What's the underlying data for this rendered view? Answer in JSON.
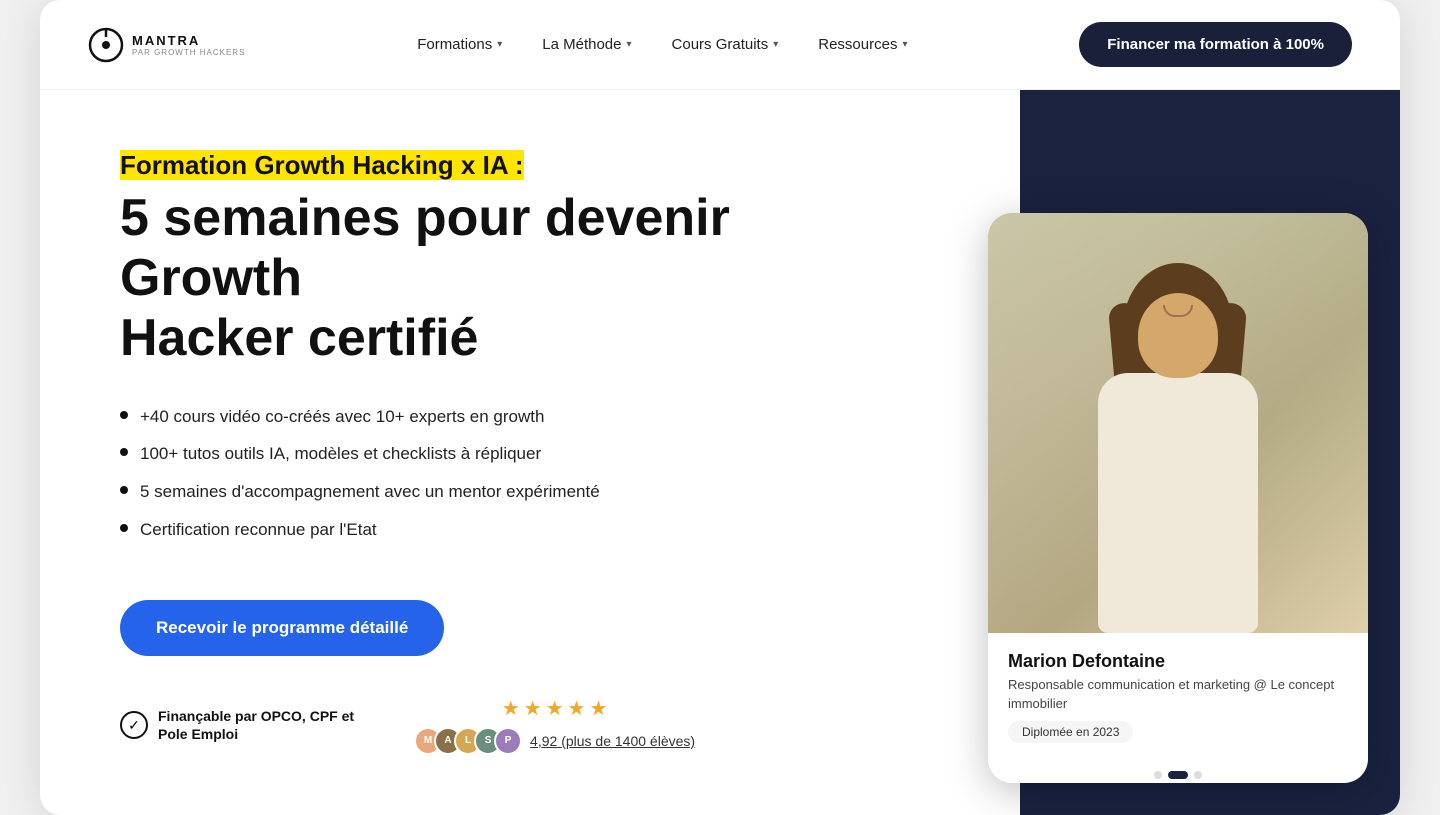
{
  "logo": {
    "name": "MANTRA",
    "subtitle": "PAR GROWTH HACKERS"
  },
  "navbar": {
    "items": [
      {
        "label": "Formations",
        "hasDropdown": true
      },
      {
        "label": "La Méthode",
        "hasDropdown": true
      },
      {
        "label": "Cours Gratuits",
        "hasDropdown": true
      },
      {
        "label": "Ressources",
        "hasDropdown": true
      }
    ],
    "cta": "Financer ma formation à 100%"
  },
  "hero": {
    "subtitle": "Formation Growth Hacking x IA :",
    "title_line1": "5 semaines pour devenir Growth",
    "title_line2": "Hacker certifié",
    "bullets": [
      "+40 cours vidéo co-créés avec 10+ experts en growth",
      "100+ tutos outils IA, modèles et checklists à répliquer",
      "5 semaines d'accompagnement avec un mentor expérimenté",
      "Certification reconnue par l'Etat"
    ],
    "cta": "Recevoir le programme détaillé",
    "financing": {
      "icon": "✓",
      "text_line1": "Finançable par OPCO, CPF et",
      "text_line2": "Pole Emploi"
    },
    "rating": {
      "score": "4,92",
      "count": "(plus de 1400 élèves)",
      "stars": 5
    }
  },
  "testimonial_card": {
    "name": "Marion Defontaine",
    "role": "Responsable communication et marketing @ Le concept immobilier",
    "badge": "Diplomée en 2023"
  }
}
